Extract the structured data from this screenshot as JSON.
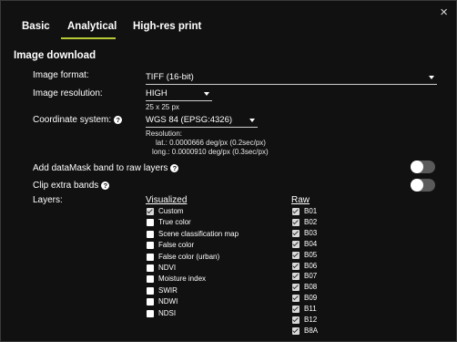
{
  "dialog": {
    "close_glyph": "×"
  },
  "tabs": [
    {
      "label": "Basic"
    },
    {
      "label": "Analytical",
      "active": true
    },
    {
      "label": "High-res print"
    }
  ],
  "accent_color": "#b8c832",
  "section_title": "Image download",
  "image_format": {
    "label": "Image format:",
    "value": "TIFF (16-bit)"
  },
  "image_resolution": {
    "label": "Image resolution:",
    "value": "HIGH",
    "size_note": "25 x 25 px"
  },
  "coordinate_system": {
    "label": "Coordinate system:",
    "value": "WGS 84 (EPSG:4326)",
    "resolution_label": "Resolution:",
    "lat": "lat.: 0.0000666 deg/px (0.2sec/px)",
    "long": "long.: 0.0000910 deg/px (0.3sec/px)"
  },
  "add_datamask": {
    "label": "Add dataMask band to raw layers",
    "enabled": false
  },
  "clip_extra_bands": {
    "label": "Clip extra bands",
    "enabled": false
  },
  "layers": {
    "label": "Layers:",
    "visualized_header": "Visualized",
    "raw_header": "Raw",
    "visualized": [
      {
        "label": "Custom",
        "checked": true
      },
      {
        "label": "True color",
        "checked": false
      },
      {
        "label": "Scene classification map",
        "checked": false
      },
      {
        "label": "False color",
        "checked": false
      },
      {
        "label": "False color (urban)",
        "checked": false
      },
      {
        "label": "NDVI",
        "checked": false
      },
      {
        "label": "Moisture index",
        "checked": false
      },
      {
        "label": "SWIR",
        "checked": false
      },
      {
        "label": "NDWI",
        "checked": false
      },
      {
        "label": "NDSI",
        "checked": false
      }
    ],
    "raw": [
      {
        "label": "B01",
        "checked": true
      },
      {
        "label": "B02",
        "checked": true
      },
      {
        "label": "B03",
        "checked": true
      },
      {
        "label": "B04",
        "checked": true
      },
      {
        "label": "B05",
        "checked": true
      },
      {
        "label": "B06",
        "checked": true
      },
      {
        "label": "B07",
        "checked": true
      },
      {
        "label": "B08",
        "checked": true
      },
      {
        "label": "B09",
        "checked": true
      },
      {
        "label": "B11",
        "checked": true
      },
      {
        "label": "B12",
        "checked": true
      },
      {
        "label": "B8A",
        "checked": true
      }
    ]
  }
}
